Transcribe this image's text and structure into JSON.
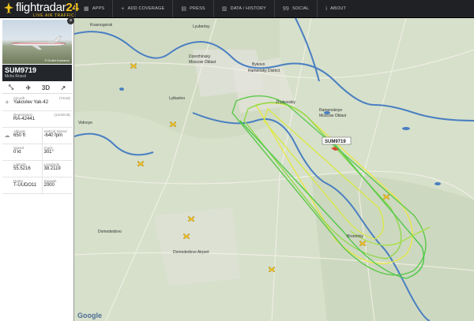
{
  "brand": {
    "name_a": "flightradar",
    "name_b": "24",
    "tagline": "LIVE AIR TRAFFIC"
  },
  "nav": [
    {
      "icon": "apps-icon",
      "glyph": "▦",
      "label": "APPS"
    },
    {
      "icon": "plus-icon",
      "glyph": "+",
      "label": "ADD COVERAGE"
    },
    {
      "icon": "press-icon",
      "glyph": "▤",
      "label": "PRESS"
    },
    {
      "icon": "history-icon",
      "glyph": "▥",
      "label": "DATA / HISTORY"
    },
    {
      "icon": "quote-icon",
      "glyph": "99",
      "label": "SOCIAL"
    },
    {
      "icon": "info-icon",
      "glyph": "i",
      "label": "ABOUT"
    }
  ],
  "flight": {
    "callsign": "SUM9719",
    "operator": "Mchs Rossii",
    "photo_credit": "© Dmitri Komarov"
  },
  "tools": [
    {
      "name": "route-icon",
      "glyph": "⤡"
    },
    {
      "name": "center-plane-icon",
      "glyph": "✈"
    },
    {
      "name": "3d-view-button",
      "label": "3D"
    },
    {
      "name": "share-icon",
      "glyph": "↗"
    }
  ],
  "details": {
    "aircraft_label": "Aircraft",
    "aircraft_code": "(YK42)",
    "aircraft": "Yakovlev Yak-42",
    "registration_label": "Registration",
    "registration_hex": "(14ADCB)",
    "registration": "RA-42441",
    "altitude_label": "Altitude",
    "altitude": "650 ft",
    "vspeed_label": "Vertical Speed",
    "vspeed": "-640 fpm",
    "speed_label": "Speed",
    "speed": "0 kt",
    "track_label": "Track",
    "track": "301°",
    "lat_label": "Latitude",
    "lat": "55.5216",
    "lon_label": "Longitude",
    "lon": "38.2119",
    "radar_label": "Radar",
    "radar": "T-UUDO11",
    "squawk_label": "Squawk",
    "squawk": "2000"
  },
  "map": {
    "labels": [
      {
        "text": "Lyubertsy"
      },
      {
        "text": "Krasnogorsk"
      },
      {
        "text": "Dzerzhinsky"
      },
      {
        "text": "Moscow Oblast"
      },
      {
        "text": "Bykovo"
      },
      {
        "text": "Ramensky District"
      },
      {
        "text": "Zhukovskiy"
      },
      {
        "text": "Ramenskoye"
      },
      {
        "text": "Moscow Oblast"
      },
      {
        "text": "Domodedovo"
      },
      {
        "text": "Domodedovo Airport"
      },
      {
        "text": "Lytkarino"
      },
      {
        "text": "Bronnitsy"
      },
      {
        "text": "Vidnoye"
      }
    ],
    "flight_label": "SUM9719",
    "google": "Google"
  },
  "colors": {
    "topbar": "#1f2124",
    "accent": "#f0c020",
    "track_green": "#4fc84a",
    "track_yellow": "#e8e84a"
  }
}
